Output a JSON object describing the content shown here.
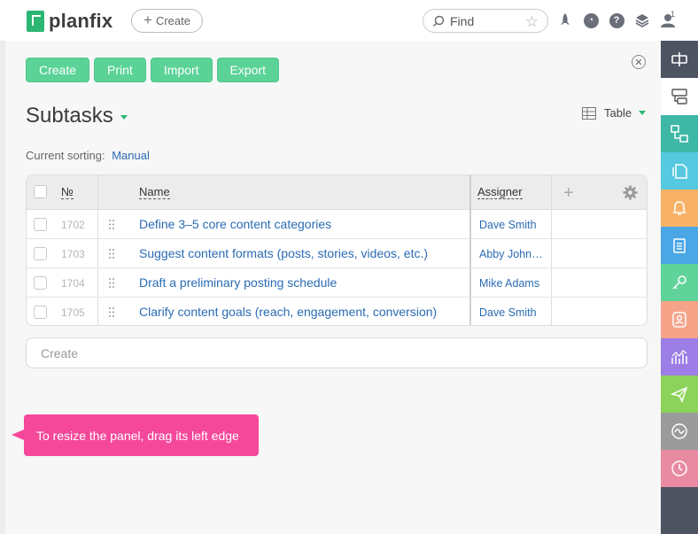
{
  "app": {
    "name": "planfix"
  },
  "topbar": {
    "create_label": "Create",
    "search_placeholder": "Find",
    "notification_count": "1"
  },
  "toolbar": {
    "buttons": [
      "Create",
      "Print",
      "Import",
      "Export"
    ]
  },
  "page": {
    "title": "Subtasks",
    "view_label": "Table",
    "sorting_label": "Current sorting:",
    "sorting_value": "Manual"
  },
  "table": {
    "columns": {
      "number": "№",
      "name": "Name",
      "assigner": "Assigner"
    },
    "rows": [
      {
        "number": "1702",
        "name": "Define 3–5 core content categories",
        "assigner": "Dave Smith"
      },
      {
        "number": "1703",
        "name": "Suggest content formats (posts, stories, videos, etc.)",
        "assigner": "Abby Johnson"
      },
      {
        "number": "1704",
        "name": "Draft a preliminary posting schedule",
        "assigner": "Mike Adams"
      },
      {
        "number": "1705",
        "name": "Clarify content goals (reach, engagement, conversion)",
        "assigner": "Dave Smith"
      }
    ]
  },
  "create_input": {
    "placeholder": "Create"
  },
  "tooltip": {
    "text": "To resize the panel, drag its left edge"
  },
  "sidebar": {
    "colors": [
      "#4d5361",
      "#ffffff",
      "#3db7a6",
      "#56c8e0",
      "#f7b267",
      "#4ba6e6",
      "#5fd39a",
      "#f5a489",
      "#9c7ee6",
      "#8bd35a",
      "#9b9b9b",
      "#e98aa3"
    ],
    "icons": [
      "panel-resize-icon",
      "subtasks-icon",
      "hierarchy-icon",
      "documents-icon",
      "notifications-icon",
      "checklist-icon",
      "key-icon",
      "contact-icon",
      "analytics-icon",
      "send-icon",
      "activity-icon",
      "history-icon"
    ]
  }
}
